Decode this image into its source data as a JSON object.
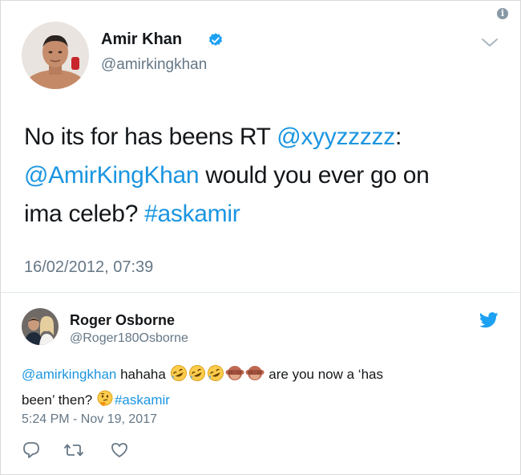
{
  "main_tweet": {
    "author_name": "Amir Khan",
    "author_handle": "@amirkingkhan",
    "text_line1_plain": "No its for has beens RT ",
    "text_line1_mention": "@xyyzzzzz",
    "text_line1_colon": ":",
    "text_line2_mention": "@AmirKingKhan",
    "text_line2_plain": " would you ever go on",
    "text_line3_plain": "ima celeb? ",
    "text_line3_hashtag": "#askamir",
    "timestamp": "16/02/2012, 07:39"
  },
  "reply_tweet": {
    "author_name": "Roger Osborne",
    "author_handle": "@Roger180Osborne",
    "mention": "@amirkingkhan",
    "text_part1": " hahaha ",
    "text_part2": " are you now a ‘has",
    "text_part3": "been’ then? ",
    "hashtag": "#askamir",
    "timestamp": "5:24 PM - Nov 19, 2017",
    "emojis": [
      "rofl-emoji",
      "rofl-emoji",
      "rofl-emoji",
      "see-no-evil-monkey-emoji",
      "see-no-evil-monkey-emoji",
      "thinking-face-emoji"
    ]
  },
  "icons": {
    "info": "info-icon",
    "verified": "verified-badge-icon",
    "chevron": "chevron-down-icon",
    "twitter": "twitter-bird-icon",
    "reply": "reply-icon",
    "retweet": "retweet-icon",
    "like": "heart-icon"
  },
  "colors": {
    "link": "#1b95e0",
    "secondary_text": "#657786",
    "primary_text": "#14171a",
    "divider": "#e1e8ed"
  }
}
